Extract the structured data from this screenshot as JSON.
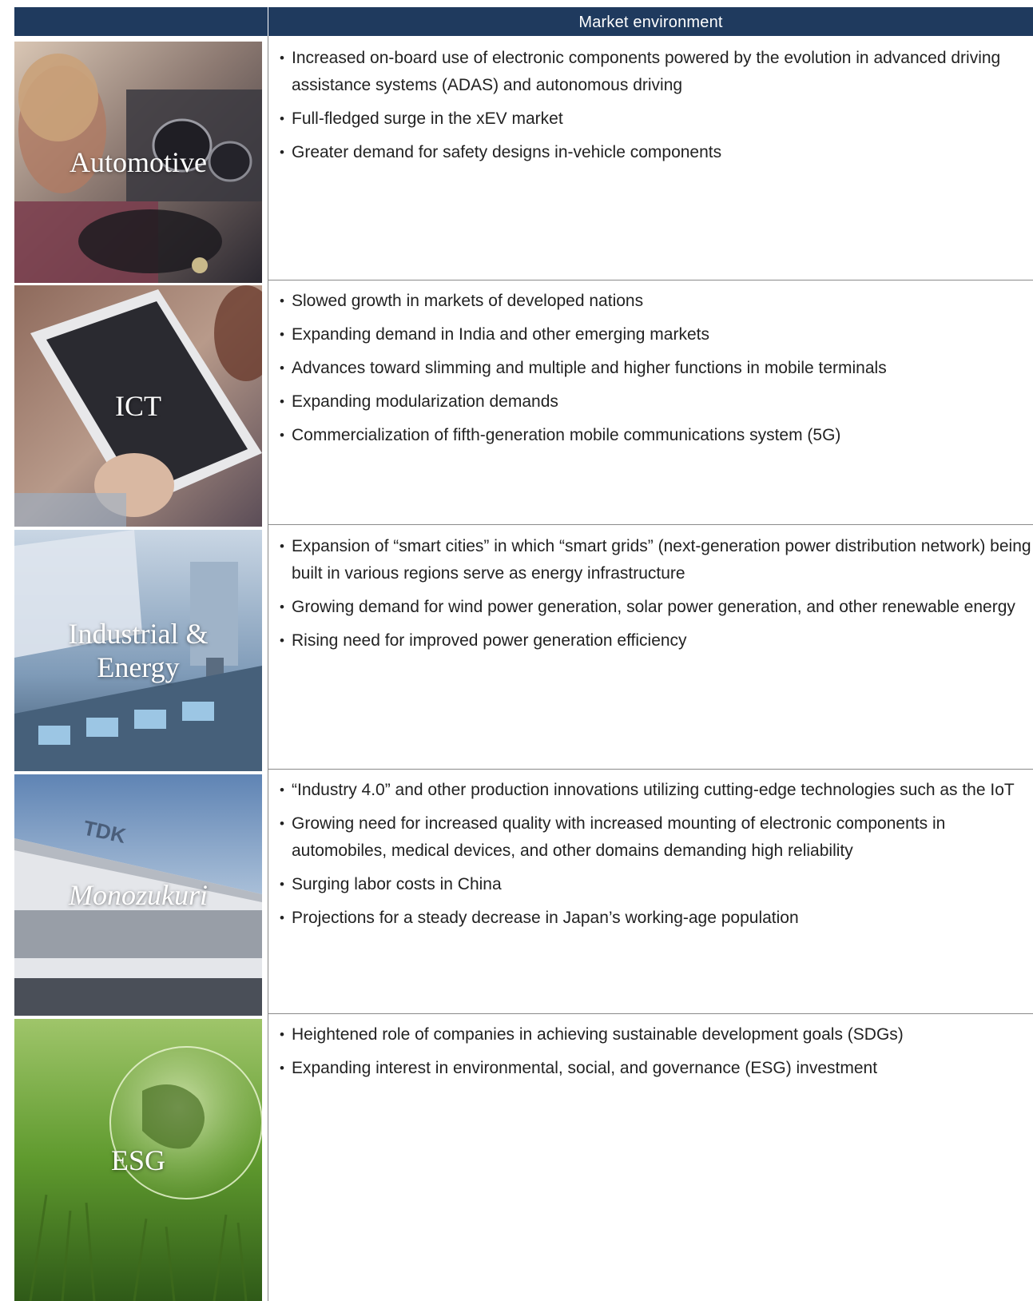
{
  "header": {
    "title": "Market environment"
  },
  "segments": [
    {
      "label": "Automotive",
      "bullets": [
        "Increased on-board use of electronic components powered by the evolution in advanced driving assistance systems (ADAS) and autonomous driving",
        "Full-fledged surge in the xEV market",
        "Greater demand for safety designs in-vehicle components"
      ]
    },
    {
      "label": "ICT",
      "bullets": [
        "Slowed growth in markets of developed nations",
        "Expanding demand in India and other emerging markets",
        "Advances toward slimming and multiple and higher functions in mobile terminals",
        "Expanding modularization demands",
        "Commercialization of fifth-generation mobile communications system (5G)"
      ]
    },
    {
      "label_line1": "Industrial &",
      "label_line2": "Energy",
      "bullets": [
        "Expansion of “smart cities” in which “smart grids” (next-generation power distribution network) being built in various regions serve as energy infrastructure",
        "Growing demand for wind power generation, solar power generation, and other renewable energy",
        "Rising need for improved power generation efficiency"
      ]
    },
    {
      "label": "Monozukuri",
      "sign_text": "TDK",
      "bullets": [
        "“Industry 4.0” and other production innovations utilizing cutting-edge technologies such as the IoT",
        "Growing need for increased quality with increased mounting of electronic components in automobiles, medical devices, and other domains demanding high reliability",
        "Surging labor costs in China",
        "Projections for a steady decrease in Japan’s working-age population"
      ]
    },
    {
      "label": "ESG",
      "bullets": [
        "Heightened role of companies in achieving sustainable development goals (SDGs)",
        "Expanding interest in environmental, social, and governance (ESG) investment"
      ]
    }
  ],
  "colors": {
    "header_bg": "#1f3a5e",
    "divider": "#8a8a8a",
    "text": "#222222"
  }
}
